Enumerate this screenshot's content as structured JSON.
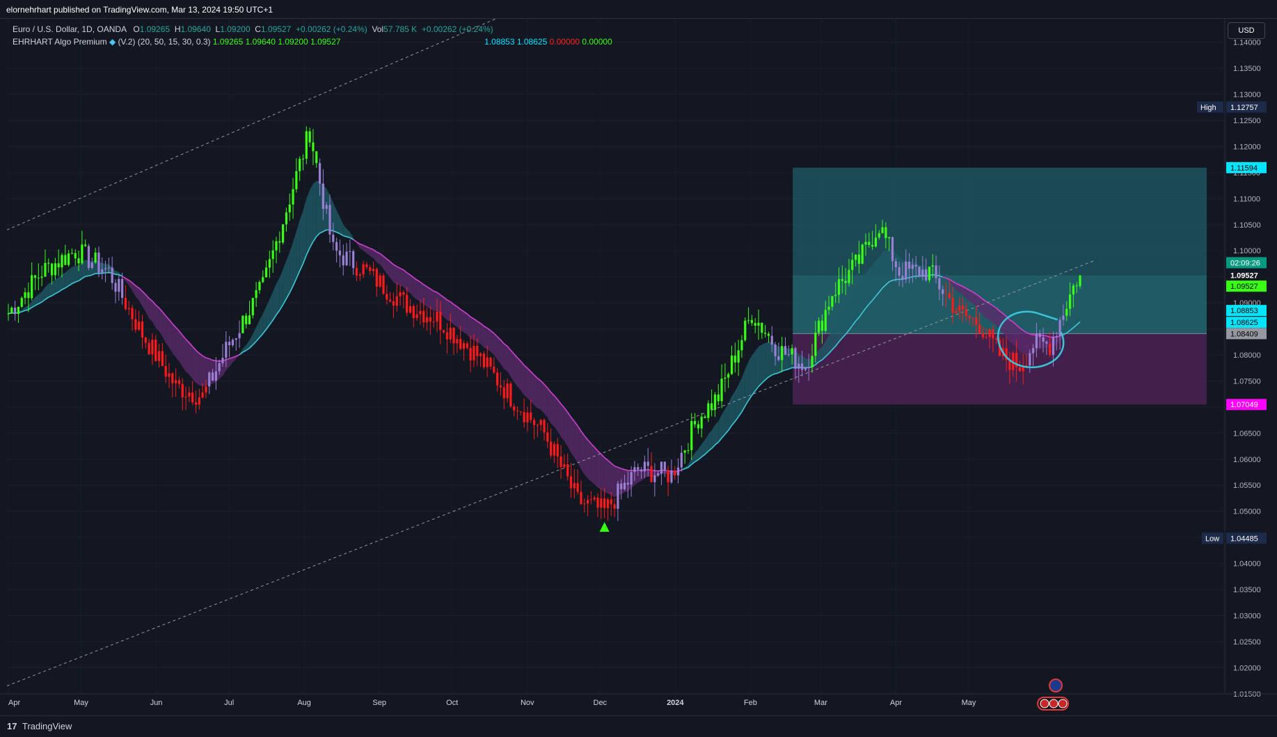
{
  "header": {
    "published": "elornehrhart published on TradingView.com, Mar 13, 2024 19:50 UTC+1"
  },
  "legend": {
    "symbol": "Euro / U.S. Dollar, 1D, OANDA",
    "o_label": "O",
    "o_value": "1.09265",
    "h_label": "H",
    "h_value": "1.09640",
    "l_label": "L",
    "l_value": "1.09200",
    "c_label": "C",
    "c_value": "1.09527",
    "change": "+0.00262 (+0.24%)",
    "vol_label": "Vol",
    "vol_value": "57.785 K",
    "vol_change": "+0.00262 (+0.24%)",
    "indicator_name": "EHRHART Algo Premium",
    "indicator_params": "(V.2) (20, 50, 15, 30, 0.3)",
    "indicator_values": [
      "1.09265",
      "1.09640",
      "1.09200",
      "1.09527"
    ],
    "indicator_values2": [
      "1.08853",
      "1.08625",
      "0.00000",
      "0.00000"
    ]
  },
  "currency_button": "USD",
  "footer": {
    "brand": "TradingView",
    "logo": "17"
  },
  "colors": {
    "background": "#131722",
    "bull": "#39ff14",
    "bear": "#ff1a1a",
    "neutral": "#9b7fd4",
    "band_up": "#1e5a66",
    "band_down": "#5a2a6a",
    "line_up": "#3fc8d8",
    "line_down": "#d040d0",
    "target_zone": "#1f5c66",
    "stop_zone": "#4a2352",
    "circle": "#39c4d8"
  },
  "chart_data": {
    "type": "candlestick",
    "x_ticks": [
      "Apr",
      "May",
      "Jun",
      "Jul",
      "Aug",
      "Sep",
      "Oct",
      "Nov",
      "Dec",
      "2024",
      "Feb",
      "Mar",
      "Apr",
      "May"
    ],
    "y_ticks": [
      "1.14000",
      "1.13500",
      "1.13000",
      "1.12500",
      "1.12000",
      "1.11500",
      "1.11000",
      "1.10500",
      "1.10000",
      "1.09500",
      "1.09000",
      "1.08500",
      "1.08000",
      "1.07500",
      "1.07000",
      "1.06500",
      "1.06000",
      "1.05500",
      "1.05000",
      "1.04500",
      "1.04000",
      "1.03500",
      "1.03000",
      "1.02500",
      "1.02000",
      "1.01500"
    ],
    "ylim": [
      1.0115,
      1.1445
    ],
    "price_labels": [
      {
        "label": "High",
        "value": "1.12757"
      },
      {
        "label": "",
        "value": "1.11594"
      },
      {
        "label": "",
        "value": "02:09:26"
      },
      {
        "label": "",
        "value": "1.09527"
      },
      {
        "label": "",
        "value": "1.09527"
      },
      {
        "label": "",
        "value": "1.08853"
      },
      {
        "label": "",
        "value": "1.08625"
      },
      {
        "label": "",
        "value": "1.08409"
      },
      {
        "label": "",
        "value": "1.07049"
      },
      {
        "label": "Low",
        "value": "1.04485"
      }
    ],
    "anchor_closes": [
      [
        0,
        1.088
      ],
      [
        10,
        1.096
      ],
      [
        20,
        1.1
      ],
      [
        30,
        1.096
      ],
      [
        40,
        1.084
      ],
      [
        50,
        1.074
      ],
      [
        58,
        1.072
      ],
      [
        65,
        1.081
      ],
      [
        76,
        1.093
      ],
      [
        90,
        1.123
      ],
      [
        97,
        1.1
      ],
      [
        105,
        1.097
      ],
      [
        118,
        1.09
      ],
      [
        128,
        1.087
      ],
      [
        140,
        1.08
      ],
      [
        150,
        1.072
      ],
      [
        160,
        1.065
      ],
      [
        170,
        1.052
      ],
      [
        178,
        1.05
      ],
      [
        188,
        1.058
      ],
      [
        198,
        1.057
      ],
      [
        206,
        1.068
      ],
      [
        212,
        1.072
      ],
      [
        222,
        1.088
      ],
      [
        230,
        1.081
      ],
      [
        238,
        1.078
      ],
      [
        246,
        1.092
      ],
      [
        254,
        1.098
      ],
      [
        260,
        1.105
      ],
      [
        266,
        1.096
      ],
      [
        275,
        1.096
      ],
      [
        284,
        1.088
      ],
      [
        290,
        1.086
      ],
      [
        296,
        1.08
      ],
      [
        302,
        1.078
      ],
      [
        306,
        1.082
      ],
      [
        311,
        1.082
      ],
      [
        316,
        1.09
      ],
      [
        319,
        1.0945
      ],
      [
        320,
        1.0953
      ]
    ],
    "signal": {
      "type": "buy-triangle",
      "index": 178,
      "value": 1.047
    },
    "channel": {
      "upper": [
        [
          0,
          1.104
        ],
        [
          320,
          1.193
        ]
      ],
      "lower": [
        [
          0,
          1.0165
        ],
        [
          320,
          1.097
        ]
      ]
    },
    "position": {
      "start_index": 303,
      "end_index": 350,
      "entry": 1.08409,
      "target": 1.11594,
      "stop": 1.07049
    }
  }
}
